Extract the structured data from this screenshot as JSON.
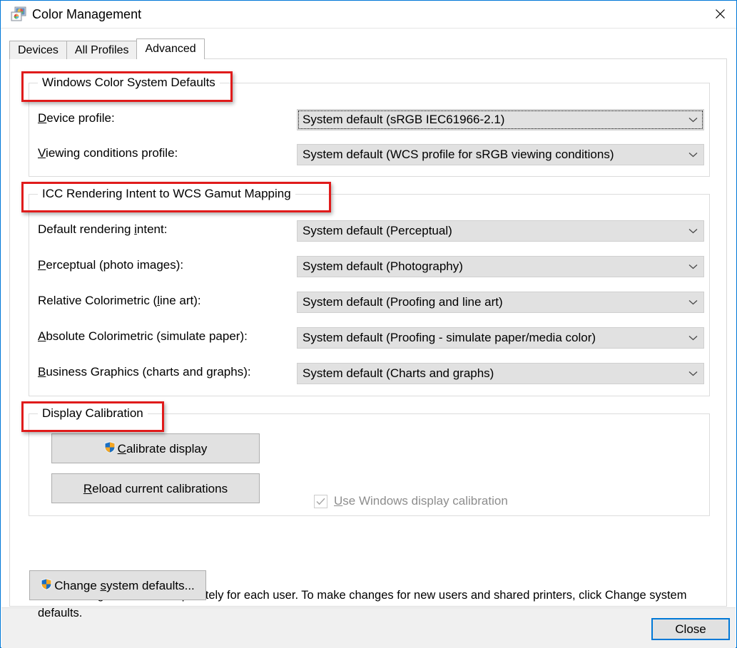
{
  "window": {
    "title": "Color Management",
    "icon": "color-management-icon",
    "close_icon": "close-icon",
    "accent_color": "#0078d7"
  },
  "tabs": [
    {
      "label": "Devices",
      "active": false
    },
    {
      "label": "All Profiles",
      "active": false
    },
    {
      "label": "Advanced",
      "active": true
    }
  ],
  "groups": {
    "wcs_defaults": {
      "title": "Windows Color System Defaults",
      "fields": [
        {
          "label_pre": "D",
          "label_post": "evice profile:",
          "value": "System default (sRGB IEC61966-2.1)",
          "focused": true
        },
        {
          "label_pre": "V",
          "label_post": "iewing conditions profile:",
          "value": "System default (WCS profile for sRGB viewing conditions)",
          "focused": false
        }
      ]
    },
    "icc_mapping": {
      "title": "ICC Rendering Intent to WCS Gamut Mapping",
      "fields": [
        {
          "label_a": "Default rendering ",
          "label_pre": "i",
          "label_post": "ntent:",
          "value": "System default (Perceptual)"
        },
        {
          "label_a": "",
          "label_pre": "P",
          "label_post": "erceptual (photo images):",
          "value": "System default (Photography)"
        },
        {
          "label_a": "Relative Colorimetric (",
          "label_pre": "l",
          "label_post": "ine art):",
          "value": "System default (Proofing and line art)"
        },
        {
          "label_a": "",
          "label_pre": "A",
          "label_post": "bsolute Colorimetric (simulate paper):",
          "value": "System default (Proofing - simulate paper/media color)"
        },
        {
          "label_a": "",
          "label_pre": "B",
          "label_post": "usiness Graphics (charts and graphs):",
          "value": "System default (Charts and graphs)"
        }
      ]
    },
    "display_calibration": {
      "title": "Display Calibration",
      "calibrate_button": {
        "label_pre": "C",
        "label_post": "alibrate display",
        "icon": "uac-shield-icon"
      },
      "reload_button": {
        "label_pre": "R",
        "label_post": "eload current calibrations"
      },
      "checkbox": {
        "label_pre": "U",
        "label_post": "se Windows display calibration",
        "checked": true,
        "disabled": true
      }
    }
  },
  "footer": {
    "description": "Color settings are stored separately for each user. To make changes for new users and shared printers, click Change system defaults.",
    "change_defaults_button": {
      "label_a": "Change ",
      "label_pre": "s",
      "label_post": "ystem defaults...",
      "icon": "uac-shield-icon"
    }
  },
  "command_bar": {
    "close_label": "Close"
  },
  "annotations": [
    {
      "name": "annotation-wcs-defaults"
    },
    {
      "name": "annotation-icc-mapping"
    },
    {
      "name": "annotation-display-calibration"
    }
  ]
}
